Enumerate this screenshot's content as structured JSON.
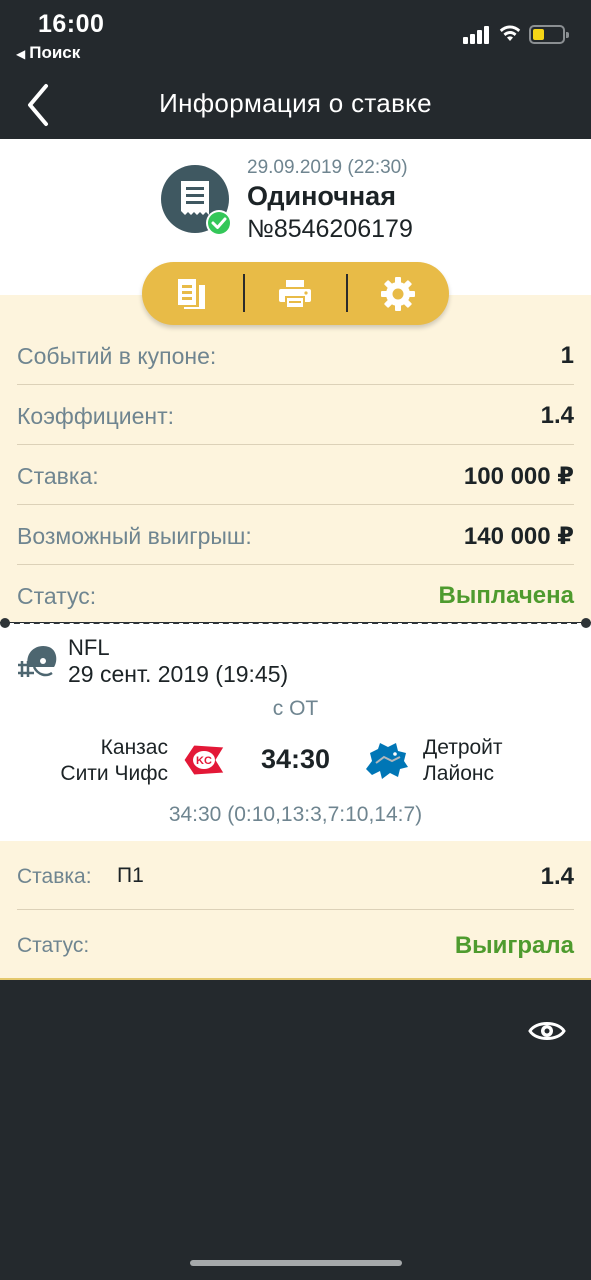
{
  "status_bar": {
    "time": "16:00",
    "back_app": "Поиск",
    "back_arrow": "◀"
  },
  "header": {
    "title": "Информация о ставке",
    "back_icon": "chevron-left-icon"
  },
  "bet": {
    "date": "29.09.2019 (22:30)",
    "type": "Одиночная",
    "number": "№8546206179",
    "icon": "receipt-icon",
    "status_icon": "check-circle-icon",
    "actions": [
      "copy-icon",
      "print-icon",
      "settings-icon"
    ]
  },
  "info": [
    {
      "label": "Событий в купоне:",
      "value": "1"
    },
    {
      "label": "Коэффициент:",
      "value": "1.4"
    },
    {
      "label": "Ставка:",
      "value": "100 000 ₽"
    },
    {
      "label": "Возможный выигрыш:",
      "value": "140 000 ₽"
    },
    {
      "label": "Статус:",
      "value": "Выплачена"
    }
  ],
  "event": {
    "league": "NFL",
    "date": "29 сент. 2019 (19:45)",
    "ot": "с ОТ",
    "home_line1": "Канзас",
    "home_line2": "Сити Чифс",
    "away_line1": "Детройт",
    "away_line2": "Лайонс",
    "score": "34:30",
    "periods": "34:30 (0:10,13:3,7:10,14:7)",
    "sport_icon": "football-helmet-icon"
  },
  "result": {
    "bet_label": "Ставка:",
    "pick": "П1",
    "odds": "1.4",
    "status_label": "Статус:",
    "status_value": "Выиграла"
  },
  "colors": {
    "dark_bg": "#24292d",
    "cream": "#fdf4dd",
    "accent_yellow": "#e8bb47",
    "green": "#4e9b2e",
    "muted": "#6f8590"
  }
}
